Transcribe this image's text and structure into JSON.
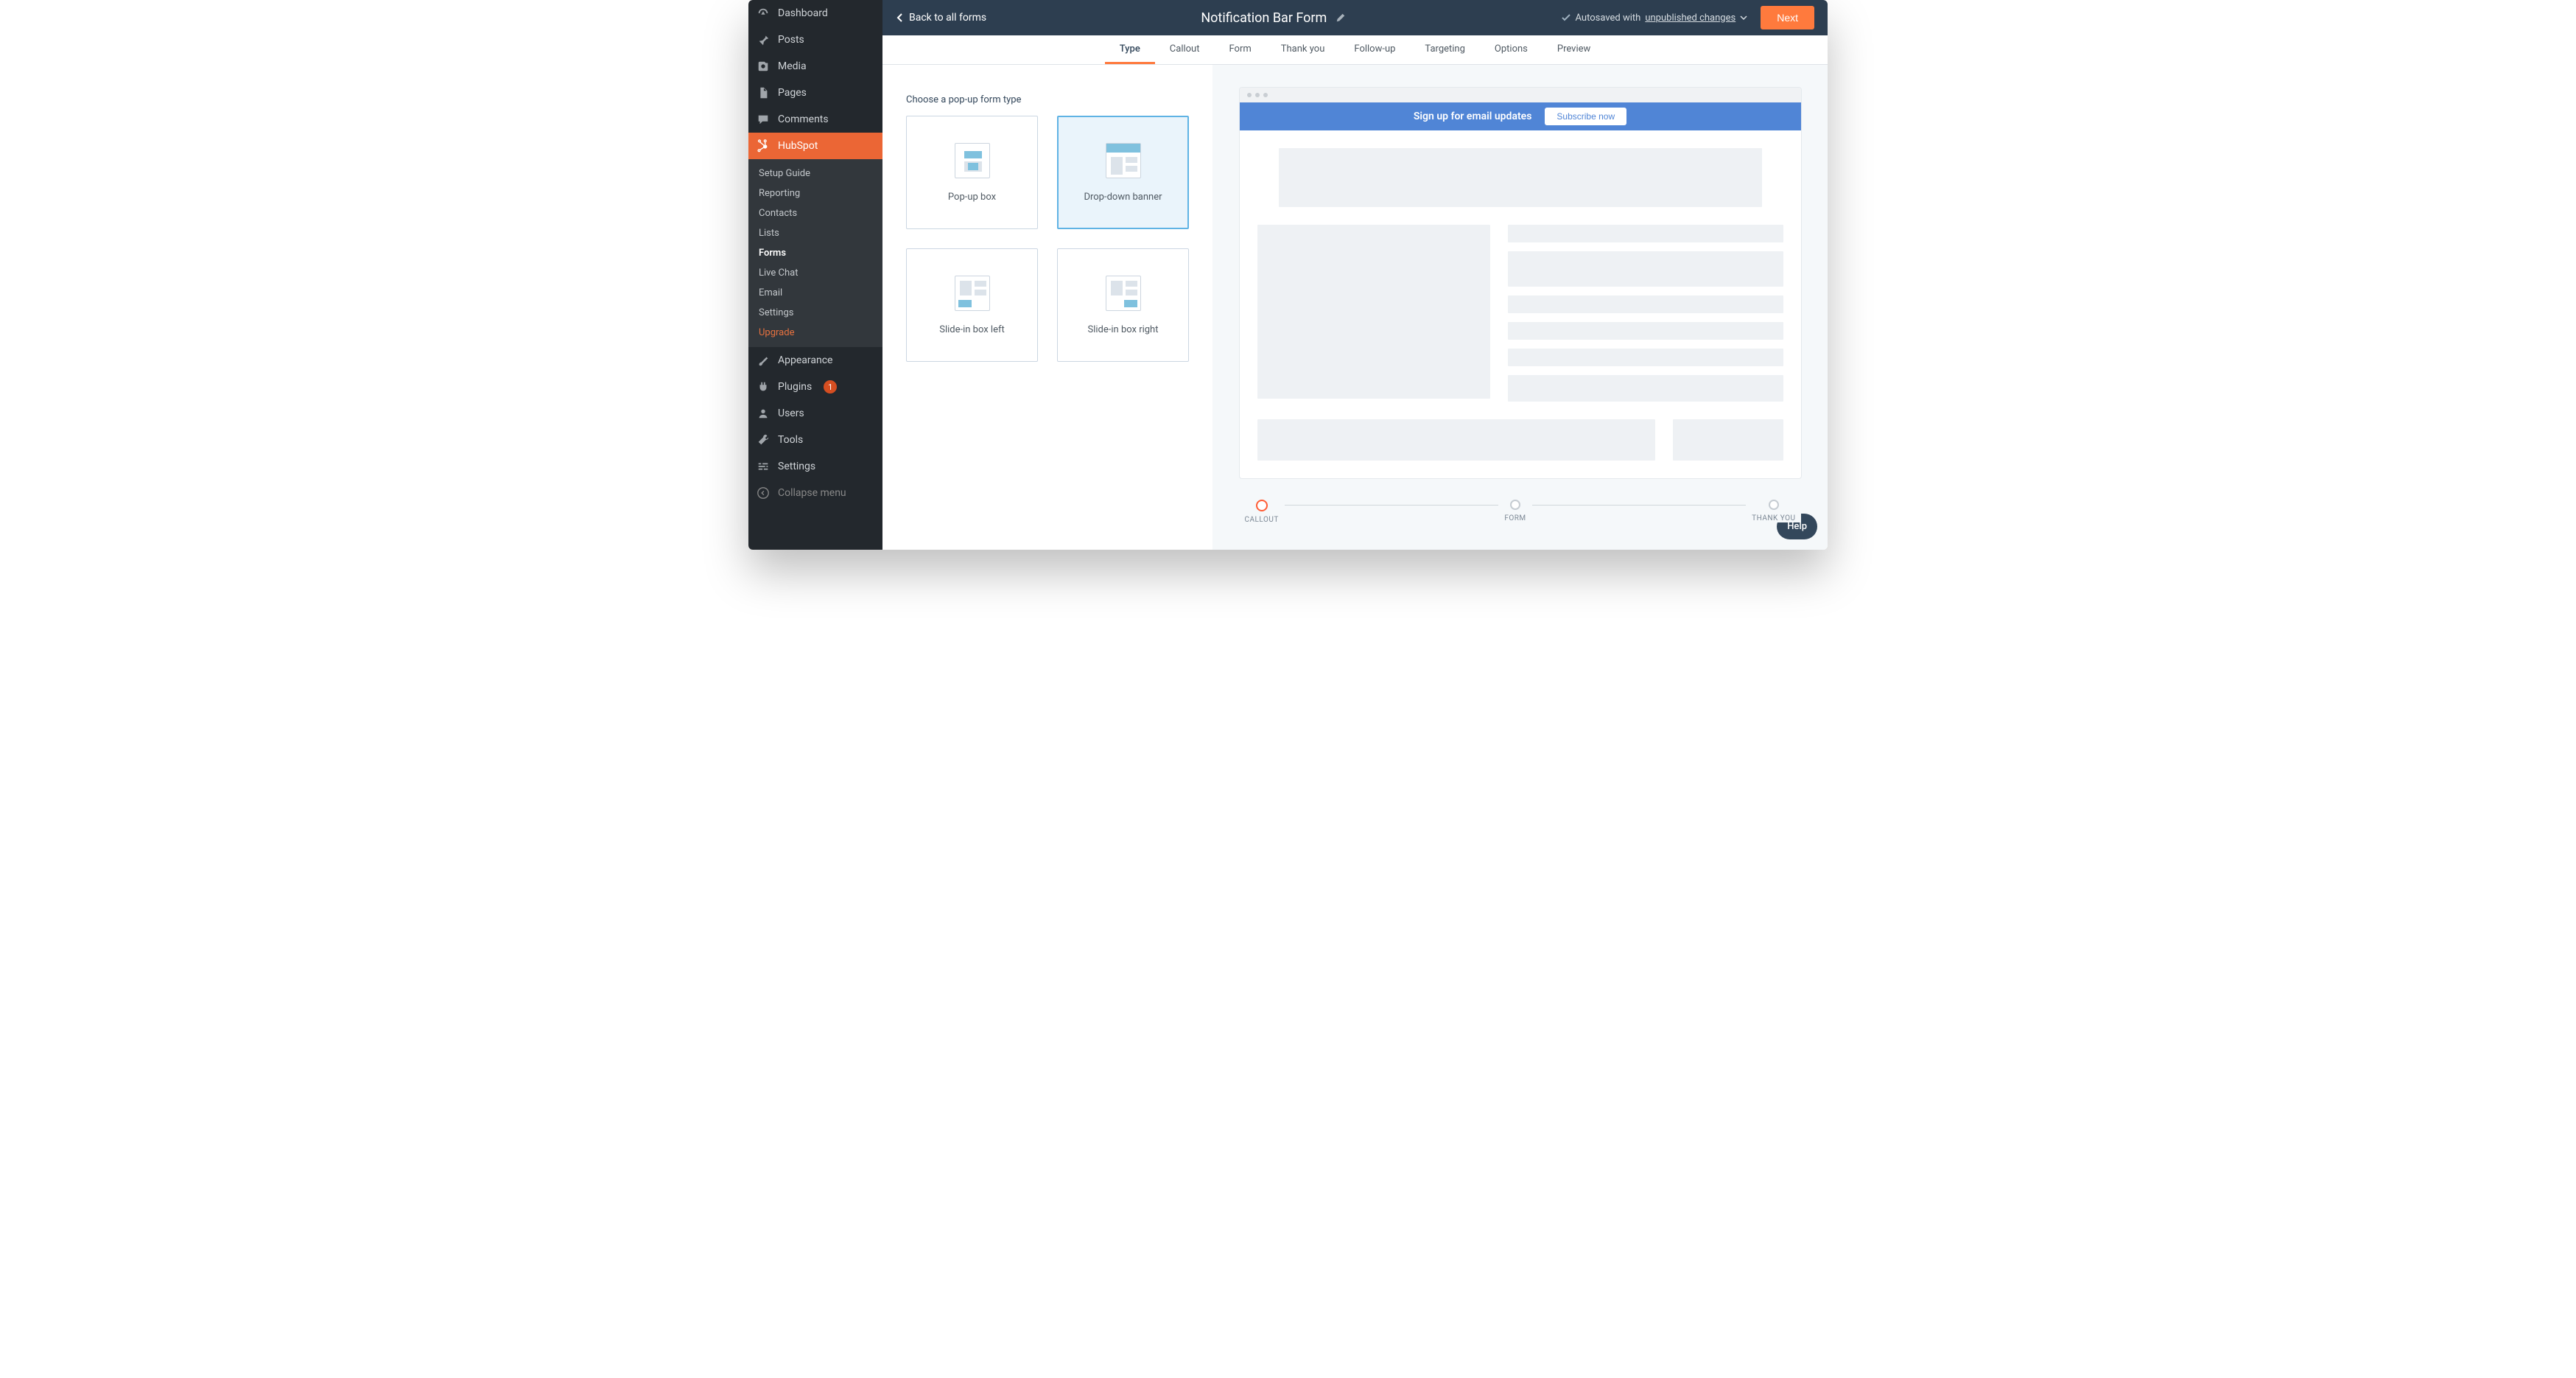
{
  "sidebar": {
    "main_items": [
      {
        "label": "Dashboard",
        "icon": "gauge"
      },
      {
        "label": "Posts",
        "icon": "pin"
      },
      {
        "label": "Media",
        "icon": "media"
      },
      {
        "label": "Pages",
        "icon": "page"
      },
      {
        "label": "Comments",
        "icon": "comment"
      },
      {
        "label": "HubSpot",
        "icon": "hubspot",
        "active": true
      }
    ],
    "sub_items": [
      {
        "label": "Setup Guide"
      },
      {
        "label": "Reporting"
      },
      {
        "label": "Contacts"
      },
      {
        "label": "Lists"
      },
      {
        "label": "Forms",
        "bold": true
      },
      {
        "label": "Live Chat"
      },
      {
        "label": "Email"
      },
      {
        "label": "Settings"
      },
      {
        "label": "Upgrade",
        "upgrade": true
      }
    ],
    "bottom_items": [
      {
        "label": "Appearance",
        "icon": "brush"
      },
      {
        "label": "Plugins",
        "icon": "plug",
        "badge": "1"
      },
      {
        "label": "Users",
        "icon": "user"
      },
      {
        "label": "Tools",
        "icon": "wrench"
      },
      {
        "label": "Settings",
        "icon": "sliders"
      }
    ],
    "collapse": "Collapse menu"
  },
  "topbar": {
    "back": "Back to all forms",
    "title": "Notification Bar Form",
    "autosave_prefix": "Autosaved with ",
    "autosave_link": "unpublished changes",
    "next": "Next"
  },
  "tabs": [
    {
      "label": "Type",
      "active": true
    },
    {
      "label": "Callout"
    },
    {
      "label": "Form"
    },
    {
      "label": "Thank you"
    },
    {
      "label": "Follow-up"
    },
    {
      "label": "Targeting"
    },
    {
      "label": "Options"
    },
    {
      "label": "Preview"
    }
  ],
  "panel": {
    "heading": "Choose a pop-up form type",
    "types": [
      {
        "label": "Pop-up box",
        "kind": "popup"
      },
      {
        "label": "Drop-down banner",
        "kind": "banner",
        "selected": true
      },
      {
        "label": "Slide-in box left",
        "kind": "slide-left"
      },
      {
        "label": "Slide-in box right",
        "kind": "slide-right"
      }
    ]
  },
  "preview": {
    "notif_text": "Sign up for email updates",
    "subscribe": "Subscribe now"
  },
  "steps": [
    {
      "label": "CALLOUT",
      "active": true
    },
    {
      "label": "FORM"
    },
    {
      "label": "THANK YOU"
    }
  ],
  "help": "Help"
}
